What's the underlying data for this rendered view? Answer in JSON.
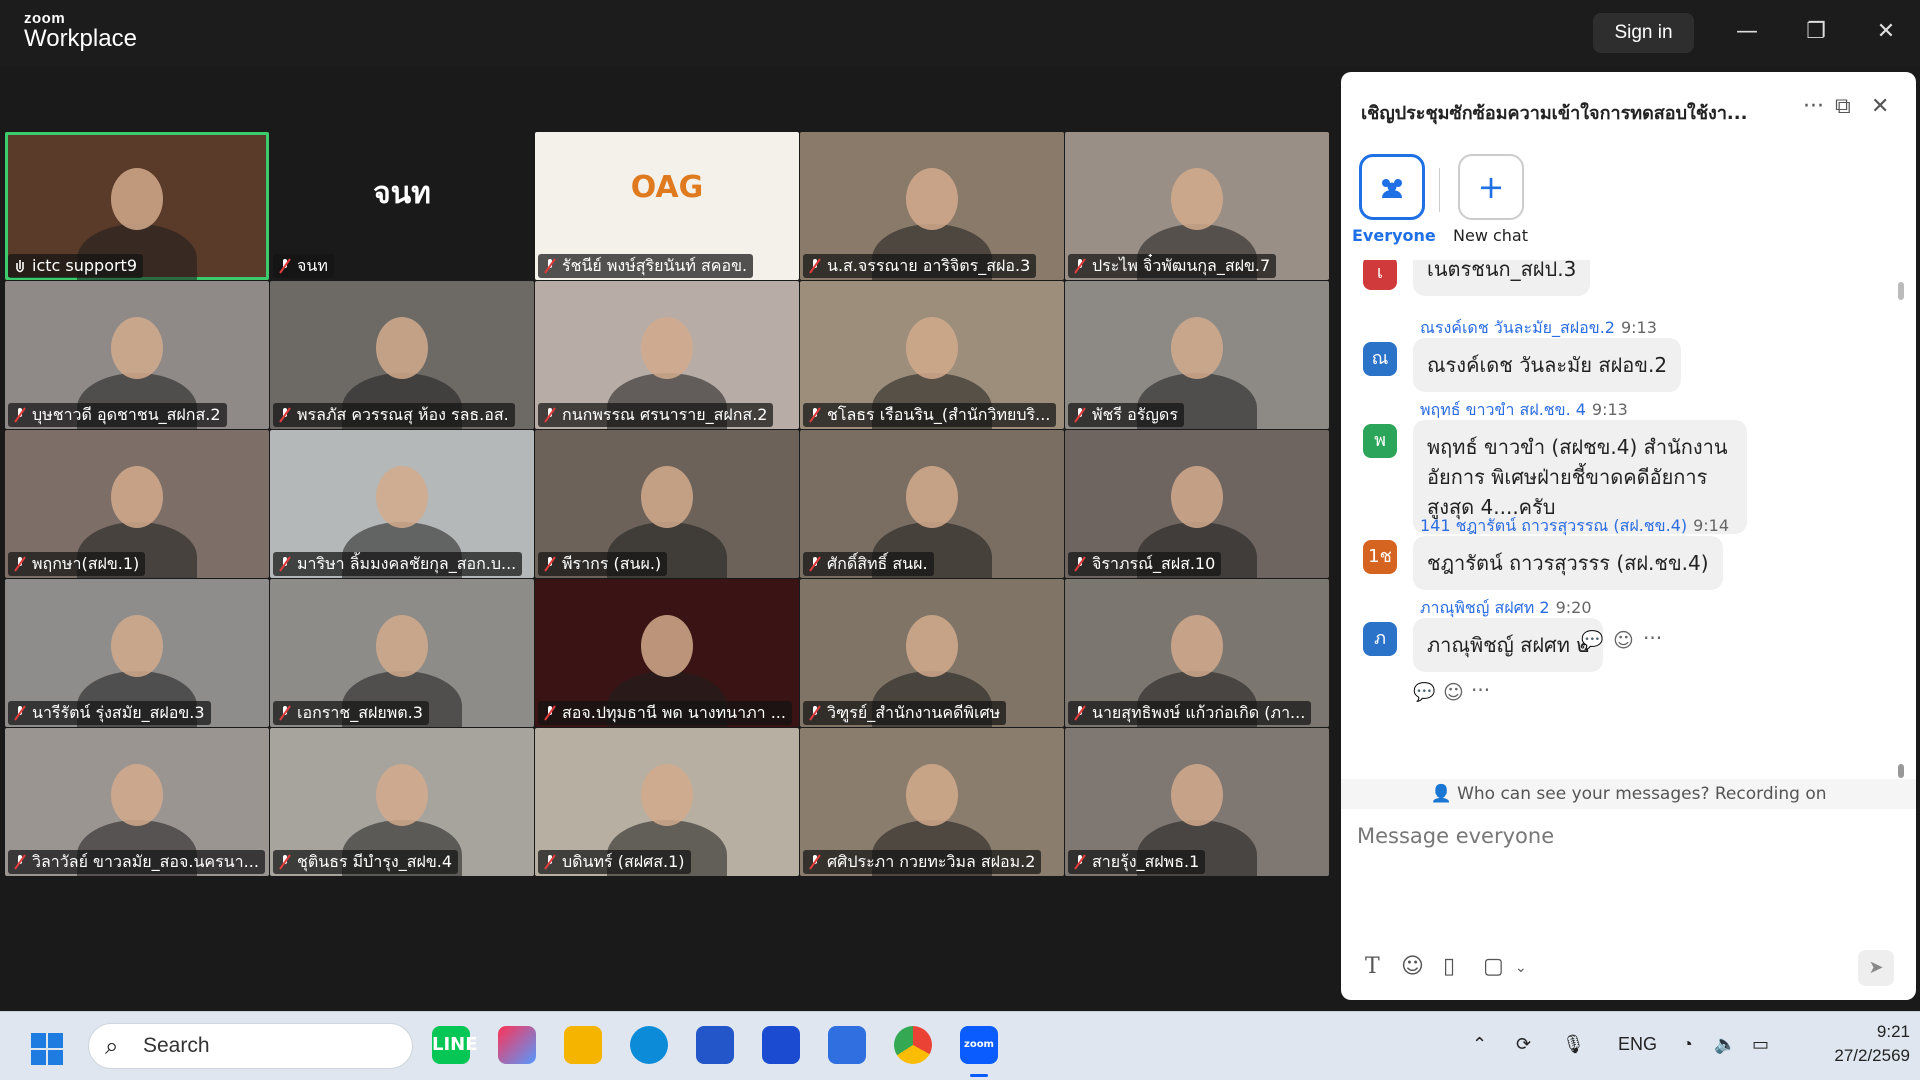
{
  "titlebar": {
    "logo_small": "zoom",
    "logo_big": "Workplace",
    "signin_label": "Sign in",
    "minimize": "—",
    "restore": "❐",
    "close": "✕"
  },
  "participants": [
    {
      "name": "ictc support9",
      "active": true,
      "tile_text": "",
      "bg": "#5a3a28"
    },
    {
      "name": "จนท",
      "tile_text": "จนท",
      "bg": "#1a1a1a"
    },
    {
      "name": "รัชนีย์ พงษ์สุริยนันท์ สคอข.",
      "tile_text": "OAG",
      "bg": "#f4f1ea"
    },
    {
      "name": "น.ส.จรรณาย อาริจิตร_สฝอ.3",
      "bg": "#8a7a6a"
    },
    {
      "name": "ประไพ จิ๋วพัฒนกุล_สฝข.7",
      "bg": "#9a8f86"
    },
    {
      "name": "บุษชาวดี อุดชาชน_สฝกส.2",
      "bg": "#8f8a88"
    },
    {
      "name": "พรลภัส ควรรณสุ ห้อง รลธ.อส.",
      "bg": "#6d6a66"
    },
    {
      "name": "กนกพรรณ ศรนาราย_สฝกส.2",
      "bg": "#b7aca6"
    },
    {
      "name": "ชโลธร เรือนริน_(สำนักวิทยบริ...",
      "bg": "#9c8e7b"
    },
    {
      "name": "พัชรี อรัญดร",
      "bg": "#8d8a86"
    },
    {
      "name": "พฤกษา(สฝข.1)",
      "bg": "#7d6f67"
    },
    {
      "name": "มาริษา ลิ้มมงคลชัยกุล_สอก.บ...",
      "bg": "#b5b8b8"
    },
    {
      "name": "พีรากร (สนผ.)",
      "bg": "#6c625a"
    },
    {
      "name": "ศักดิ์สิทธิ์ สนผ.",
      "bg": "#7a6e63"
    },
    {
      "name": "จิราภรณ์_สฝส.10",
      "bg": "#6e6560"
    },
    {
      "name": "นารีรัตน์ รุ่งสมัย_สฝอข.3",
      "bg": "#8f8d8c"
    },
    {
      "name": "เอกราช_สฝยพต.3",
      "bg": "#8e8c88"
    },
    {
      "name": "สอจ.ปทุมธานี พด นางทนาภา ...",
      "bg": "#3a1414"
    },
    {
      "name": "วิฑูรย์_สำนักงานคดีพิเศษ",
      "bg": "#7f7466"
    },
    {
      "name": "นายสุทธิพงษ์ แก้วก่อเกิด (ภา...",
      "bg": "#7c7670"
    },
    {
      "name": "วิลาวัลย์ ขาวลมัย_สอจ.นครนา...",
      "bg": "#9b9592"
    },
    {
      "name": "ชุตินธร มีบำรุง_สฝข.4",
      "bg": "#a7a49e"
    },
    {
      "name": "บดินทร์ (สฝศส.1)",
      "bg": "#b7b0a2"
    },
    {
      "name": "ศศิประภา กวยทะวิมล สฝอม.2",
      "bg": "#8b7d6d"
    },
    {
      "name": "สายรุ้ง_สฝพธ.1",
      "bg": "#7e7772"
    }
  ],
  "chat": {
    "title": "เชิญประชุมซักซ้อมความเข้าใจการทดสอบใช้งา...",
    "more_icon": "···",
    "popout_icon": "⧉",
    "close_icon": "✕",
    "tab_everyone": "Everyone",
    "tab_new_chat": "New chat",
    "messages": [
      {
        "avatar": "เ",
        "avatar_color": "#d03a3a",
        "sender": "",
        "time": "",
        "text": "เนตรชนก_สฝป.3"
      },
      {
        "avatar": "ณ",
        "avatar_color": "#2b72c9",
        "sender": "ณรงค์เดช วันละมัย_สฝอข.2",
        "time": "9:13",
        "text": "ณรงค์เดช วันละมัย สฝอข.2"
      },
      {
        "avatar": "พ",
        "avatar_color": "#2aa55a",
        "sender": "พฤทธ์ ขาวขำ สฝ.ชข. 4",
        "time": "9:13",
        "text": "พฤทธ์ ขาวขำ (สฝชข.4) สำนักงานอัยการ พิเศษฝ่ายชี้ขาดคดีอัยการสูงสุด 4....ครับ"
      },
      {
        "avatar": "1ช",
        "avatar_color": "#d4641f",
        "sender": "141 ชฎารัตน์ ถาวรสุวรรณ (สฝ.ชข.4)",
        "time": "9:14",
        "text": "ชฎารัตน์ ถาวรสุวรรร (สฝ.ชข.4)"
      },
      {
        "avatar": "ภ",
        "avatar_color": "#2b72c9",
        "sender": "ภาณุพิชญ์ สฝศท 2",
        "time": "9:20",
        "text": "ภาณุพิชญ์ สฝศท ๒"
      }
    ],
    "notice": "Who can see your messages? Recording on",
    "input_placeholder": "Message everyone"
  },
  "taskbar": {
    "search_label": "Search",
    "lang": "ENG",
    "time": "9:21",
    "date": "27/2/2569"
  }
}
